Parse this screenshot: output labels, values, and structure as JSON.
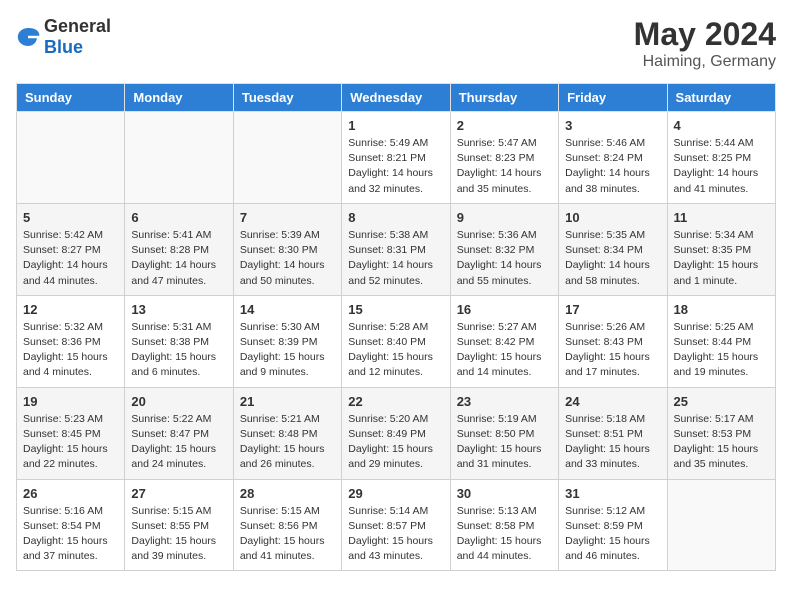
{
  "logo": {
    "general": "General",
    "blue": "Blue"
  },
  "title": {
    "month_year": "May 2024",
    "location": "Haiming, Germany"
  },
  "calendar": {
    "headers": [
      "Sunday",
      "Monday",
      "Tuesday",
      "Wednesday",
      "Thursday",
      "Friday",
      "Saturday"
    ],
    "weeks": [
      [
        {
          "day": "",
          "info": ""
        },
        {
          "day": "",
          "info": ""
        },
        {
          "day": "",
          "info": ""
        },
        {
          "day": "1",
          "info": "Sunrise: 5:49 AM\nSunset: 8:21 PM\nDaylight: 14 hours\nand 32 minutes."
        },
        {
          "day": "2",
          "info": "Sunrise: 5:47 AM\nSunset: 8:23 PM\nDaylight: 14 hours\nand 35 minutes."
        },
        {
          "day": "3",
          "info": "Sunrise: 5:46 AM\nSunset: 8:24 PM\nDaylight: 14 hours\nand 38 minutes."
        },
        {
          "day": "4",
          "info": "Sunrise: 5:44 AM\nSunset: 8:25 PM\nDaylight: 14 hours\nand 41 minutes."
        }
      ],
      [
        {
          "day": "5",
          "info": "Sunrise: 5:42 AM\nSunset: 8:27 PM\nDaylight: 14 hours\nand 44 minutes."
        },
        {
          "day": "6",
          "info": "Sunrise: 5:41 AM\nSunset: 8:28 PM\nDaylight: 14 hours\nand 47 minutes."
        },
        {
          "day": "7",
          "info": "Sunrise: 5:39 AM\nSunset: 8:30 PM\nDaylight: 14 hours\nand 50 minutes."
        },
        {
          "day": "8",
          "info": "Sunrise: 5:38 AM\nSunset: 8:31 PM\nDaylight: 14 hours\nand 52 minutes."
        },
        {
          "day": "9",
          "info": "Sunrise: 5:36 AM\nSunset: 8:32 PM\nDaylight: 14 hours\nand 55 minutes."
        },
        {
          "day": "10",
          "info": "Sunrise: 5:35 AM\nSunset: 8:34 PM\nDaylight: 14 hours\nand 58 minutes."
        },
        {
          "day": "11",
          "info": "Sunrise: 5:34 AM\nSunset: 8:35 PM\nDaylight: 15 hours\nand 1 minute."
        }
      ],
      [
        {
          "day": "12",
          "info": "Sunrise: 5:32 AM\nSunset: 8:36 PM\nDaylight: 15 hours\nand 4 minutes."
        },
        {
          "day": "13",
          "info": "Sunrise: 5:31 AM\nSunset: 8:38 PM\nDaylight: 15 hours\nand 6 minutes."
        },
        {
          "day": "14",
          "info": "Sunrise: 5:30 AM\nSunset: 8:39 PM\nDaylight: 15 hours\nand 9 minutes."
        },
        {
          "day": "15",
          "info": "Sunrise: 5:28 AM\nSunset: 8:40 PM\nDaylight: 15 hours\nand 12 minutes."
        },
        {
          "day": "16",
          "info": "Sunrise: 5:27 AM\nSunset: 8:42 PM\nDaylight: 15 hours\nand 14 minutes."
        },
        {
          "day": "17",
          "info": "Sunrise: 5:26 AM\nSunset: 8:43 PM\nDaylight: 15 hours\nand 17 minutes."
        },
        {
          "day": "18",
          "info": "Sunrise: 5:25 AM\nSunset: 8:44 PM\nDaylight: 15 hours\nand 19 minutes."
        }
      ],
      [
        {
          "day": "19",
          "info": "Sunrise: 5:23 AM\nSunset: 8:45 PM\nDaylight: 15 hours\nand 22 minutes."
        },
        {
          "day": "20",
          "info": "Sunrise: 5:22 AM\nSunset: 8:47 PM\nDaylight: 15 hours\nand 24 minutes."
        },
        {
          "day": "21",
          "info": "Sunrise: 5:21 AM\nSunset: 8:48 PM\nDaylight: 15 hours\nand 26 minutes."
        },
        {
          "day": "22",
          "info": "Sunrise: 5:20 AM\nSunset: 8:49 PM\nDaylight: 15 hours\nand 29 minutes."
        },
        {
          "day": "23",
          "info": "Sunrise: 5:19 AM\nSunset: 8:50 PM\nDaylight: 15 hours\nand 31 minutes."
        },
        {
          "day": "24",
          "info": "Sunrise: 5:18 AM\nSunset: 8:51 PM\nDaylight: 15 hours\nand 33 minutes."
        },
        {
          "day": "25",
          "info": "Sunrise: 5:17 AM\nSunset: 8:53 PM\nDaylight: 15 hours\nand 35 minutes."
        }
      ],
      [
        {
          "day": "26",
          "info": "Sunrise: 5:16 AM\nSunset: 8:54 PM\nDaylight: 15 hours\nand 37 minutes."
        },
        {
          "day": "27",
          "info": "Sunrise: 5:15 AM\nSunset: 8:55 PM\nDaylight: 15 hours\nand 39 minutes."
        },
        {
          "day": "28",
          "info": "Sunrise: 5:15 AM\nSunset: 8:56 PM\nDaylight: 15 hours\nand 41 minutes."
        },
        {
          "day": "29",
          "info": "Sunrise: 5:14 AM\nSunset: 8:57 PM\nDaylight: 15 hours\nand 43 minutes."
        },
        {
          "day": "30",
          "info": "Sunrise: 5:13 AM\nSunset: 8:58 PM\nDaylight: 15 hours\nand 44 minutes."
        },
        {
          "day": "31",
          "info": "Sunrise: 5:12 AM\nSunset: 8:59 PM\nDaylight: 15 hours\nand 46 minutes."
        },
        {
          "day": "",
          "info": ""
        }
      ]
    ]
  }
}
